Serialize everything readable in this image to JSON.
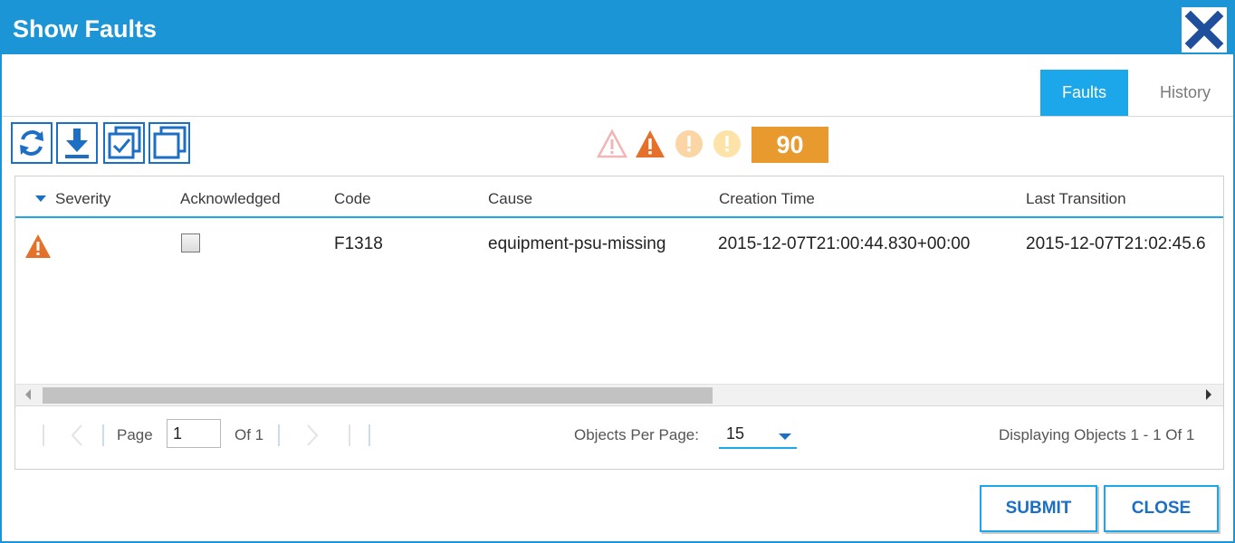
{
  "dialog": {
    "title": "Show Faults",
    "close_icon": "close-x-icon",
    "brand_color": "#1b95d6"
  },
  "tabs": [
    {
      "label": "Faults",
      "active": true
    },
    {
      "label": "History",
      "active": false
    }
  ],
  "toolbar": {
    "buttons": [
      {
        "icon": "refresh-icon"
      },
      {
        "icon": "download-icon"
      },
      {
        "icon": "select-all-icon"
      },
      {
        "icon": "deselect-all-icon"
      }
    ]
  },
  "severity_summary": {
    "icons": [
      "critical-outline-icon",
      "major-warning-icon",
      "minor-info-icon",
      "warning-info-icon"
    ],
    "total_count": "90",
    "badge_color": "#e89a2e"
  },
  "grid": {
    "columns": [
      "Severity",
      "Acknowledged",
      "Code",
      "Cause",
      "Creation Time",
      "Last Transition"
    ],
    "sorted_column": "Severity",
    "rows": [
      {
        "severity_icon": "major-warning-icon",
        "acknowledged": false,
        "code": "F1318",
        "cause": "equipment-psu-missing",
        "creation_time": "2015-12-07T21:00:44.830+00:00",
        "last_transition": "2015-12-07T21:02:45.6"
      }
    ]
  },
  "pager": {
    "page_label": "Page",
    "page_value": "1",
    "of_label": "Of 1",
    "objects_per_page_label": "Objects Per Page:",
    "objects_per_page_value": "15",
    "displaying_text": "Displaying Objects 1 - 1 Of 1"
  },
  "footer": {
    "submit_label": "SUBMIT",
    "close_label": "CLOSE"
  }
}
